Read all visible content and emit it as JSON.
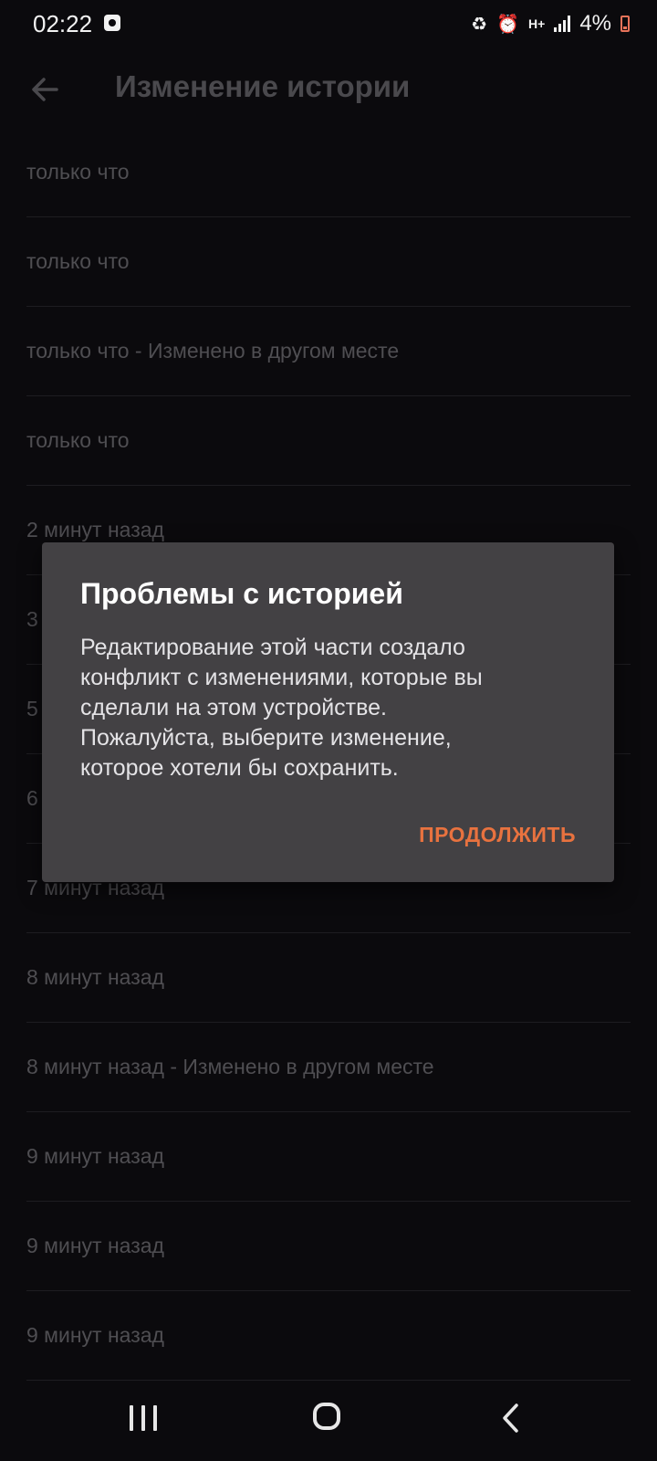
{
  "status_bar": {
    "time": "02:22",
    "network": "H+",
    "battery": "4%"
  },
  "app_bar": {
    "title": "Изменение истории",
    "back_icon": "arrow-left-icon"
  },
  "history": {
    "items": [
      {
        "label": "только что"
      },
      {
        "label": "только что"
      },
      {
        "label": "только что - Изменено в другом месте"
      },
      {
        "label": "только что"
      },
      {
        "label": "2 минут назад"
      },
      {
        "label": "3"
      },
      {
        "label": "5"
      },
      {
        "label": "6"
      },
      {
        "label": "7 минут назад"
      },
      {
        "label": "8 минут назад"
      },
      {
        "label": "8 минут назад - Изменено в другом месте"
      },
      {
        "label": "9 минут назад"
      },
      {
        "label": "9 минут назад"
      },
      {
        "label": "9 минут назад"
      }
    ]
  },
  "dialog": {
    "title": "Проблемы с историей",
    "body": "Редактирование этой части создало конфликт с изменениями, которые вы сделали на этом устройстве. Пожалуйста, выберите изменение, которое хотели бы сохранить.",
    "action_label": "ПРОДОЛЖИТЬ"
  },
  "colors": {
    "background": "#0b0a0d",
    "dialog": "#434144",
    "accent": "#e8723f"
  }
}
